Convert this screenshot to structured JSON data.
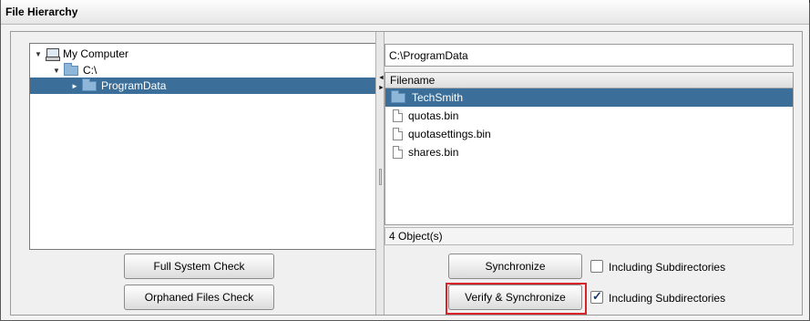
{
  "window": {
    "title": "File Hierarchy"
  },
  "tree": {
    "items": [
      {
        "label": "My Computer",
        "icon": "computer-icon",
        "expanded": true
      },
      {
        "label": "C:\\",
        "icon": "folder-icon",
        "expanded": true
      },
      {
        "label": "ProgramData",
        "icon": "folder-icon",
        "expanded": false,
        "selected": true
      }
    ]
  },
  "left_buttons": {
    "full_check": "Full System Check",
    "orphaned_check": "Orphaned Files Check"
  },
  "path": {
    "value": "C:\\ProgramData"
  },
  "filelist": {
    "header": "Filename",
    "rows": [
      {
        "name": "TechSmith",
        "icon": "folder-icon",
        "selected": true
      },
      {
        "name": "quotas.bin",
        "icon": "file-icon",
        "selected": false
      },
      {
        "name": "quotasettings.bin",
        "icon": "file-icon",
        "selected": false
      },
      {
        "name": "shares.bin",
        "icon": "file-icon",
        "selected": false
      }
    ],
    "status": "4 Object(s)"
  },
  "right_buttons": {
    "synchronize": "Synchronize",
    "verify_sync": "Verify & Synchronize",
    "sync_subdirs_label": "Including Subdirectories",
    "sync_subdirs_checked": false,
    "verify_subdirs_label": "Including Subdirectories",
    "verify_subdirs_checked": true
  },
  "colors": {
    "selection": "#3b6f9a",
    "highlight_box": "#d9232b"
  }
}
